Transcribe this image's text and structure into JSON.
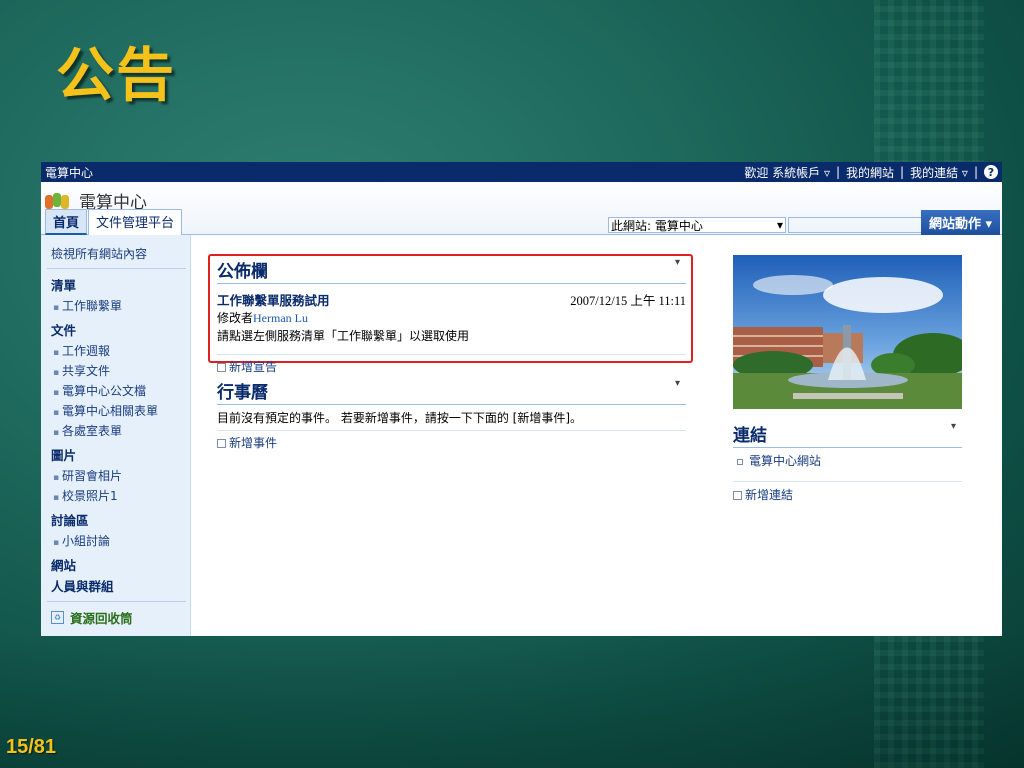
{
  "slide": {
    "title": "公告",
    "page_number": "15/81"
  },
  "topbar": {
    "site": "電算中心",
    "welcome": "歡迎 系統帳戶",
    "my_site": "我的網站",
    "my_links": "我的連結",
    "help_icon": "?"
  },
  "header": {
    "site_name": "電算中心",
    "search_scope": "此網站: 電算中心",
    "site_actions": "網站動作 ▾"
  },
  "tabs": [
    {
      "label": "首頁"
    },
    {
      "label": "文件管理平台"
    }
  ],
  "quicklaunch": {
    "view_all": "檢視所有網站內容",
    "sections": [
      {
        "head": "清單",
        "items": [
          "工作聯繫單"
        ]
      },
      {
        "head": "文件",
        "items": [
          "工作週報",
          "共享文件",
          "電算中心公文檔",
          "電算中心相關表單",
          "各處室表單"
        ]
      },
      {
        "head": "圖片",
        "items": [
          "研習會相片",
          "校景照片1"
        ]
      },
      {
        "head": "討論區",
        "items": [
          "小組討論"
        ]
      },
      {
        "head": "網站",
        "items": []
      },
      {
        "head": "人員與群組",
        "items": []
      }
    ],
    "recycle": "資源回收筒"
  },
  "announcements": {
    "title": "公佈欄",
    "item_title": "工作聯繫單服務試用",
    "date": "2007/12/15 上午 11:11",
    "modified_prefix": "修改者",
    "modified_user": "Herman Lu",
    "body": "請點選左側服務清單「工作聯繫單」以選取使用",
    "add": "新增宣告"
  },
  "calendar": {
    "title": "行事曆",
    "body": "目前沒有預定的事件。 若要新增事件，請按一下下面的 [新增事件]。",
    "add": "新增事件"
  },
  "links": {
    "title": "連結",
    "items": [
      "電算中心網站"
    ],
    "add": "新增連結"
  },
  "colors": {
    "title_gold": "#f4c21a",
    "topbar_navy": "#0a2b6b",
    "highlight_red": "#e02020"
  }
}
